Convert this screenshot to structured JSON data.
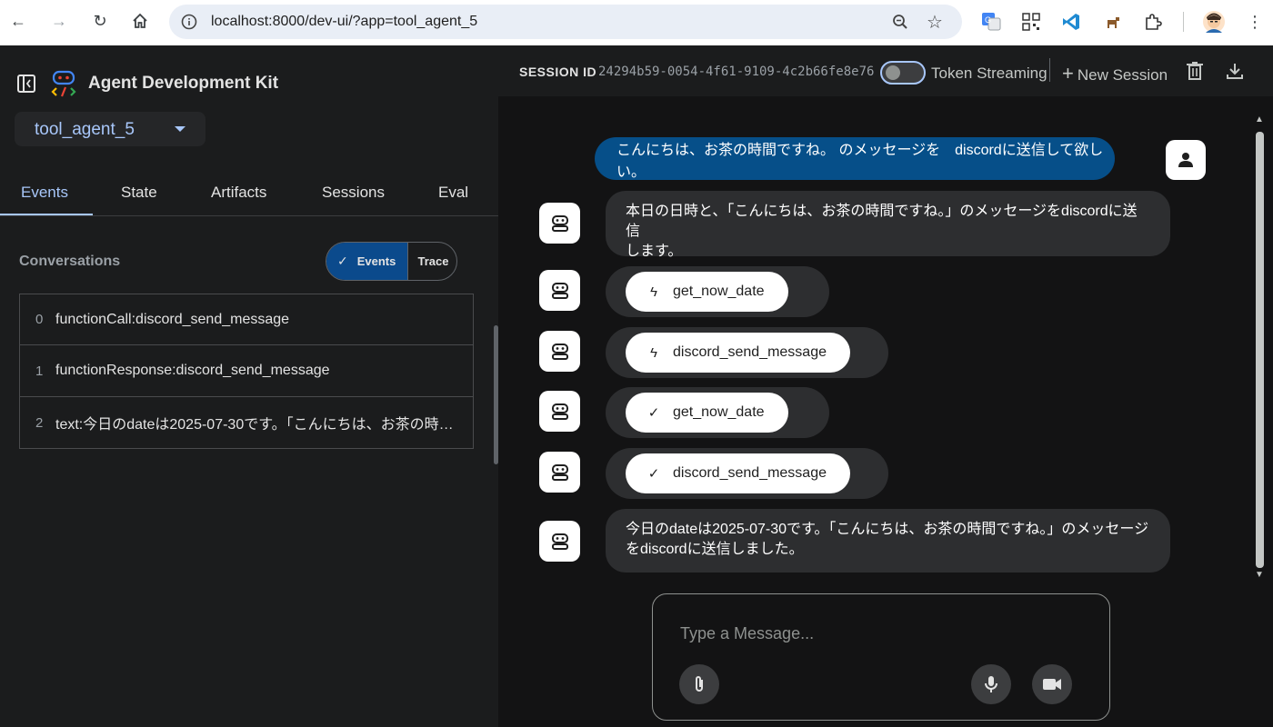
{
  "browser": {
    "url": "localhost:8000/dev-ui/?app=tool_agent_5"
  },
  "sidebar": {
    "title": "Agent Development Kit",
    "app_selected": "tool_agent_5",
    "tabs": [
      {
        "label": "Events"
      },
      {
        "label": "State"
      },
      {
        "label": "Artifacts"
      },
      {
        "label": "Sessions"
      },
      {
        "label": "Eval"
      }
    ],
    "conversations_label": "Conversations",
    "view_toggle": {
      "events": "Events",
      "trace": "Trace"
    },
    "events": [
      {
        "index": "0",
        "text": "functionCall:discord_send_message"
      },
      {
        "index": "1",
        "text": "functionResponse:discord_send_message"
      },
      {
        "index": "2",
        "text": "text:今日のdateは2025-07-30です。「こんにちは、お茶の時…"
      }
    ]
  },
  "session": {
    "label": "SESSION ID",
    "id": "24294b59-0054-4f61-9109-4c2b66fe8e76",
    "token_streaming_label": "Token Streaming",
    "token_streaming_on": false,
    "new_session_label": "New Session"
  },
  "chat": {
    "user_message": "こんにちは、お茶の時間ですね。 のメッセージを　discordに送信して欲しい。",
    "bot_intro_line1": "本日の日時と、「こんにちは、お茶の時間ですね。」のメッセージをdiscordに送信",
    "bot_intro_line2": "します。",
    "tool_calls": [
      {
        "name": "get_now_date",
        "kind": "call"
      },
      {
        "name": "discord_send_message",
        "kind": "call"
      },
      {
        "name": "get_now_date",
        "kind": "response"
      },
      {
        "name": "discord_send_message",
        "kind": "response"
      }
    ],
    "bot_final_line1": "今日のdateは2025-07-30です。「こんにちは、お茶の時間ですね。」のメッセージ",
    "bot_final_line2": "をdiscordに送信しました。"
  },
  "composer": {
    "placeholder": "Type a Message..."
  },
  "colors": {
    "accent": "#a8c7fa",
    "user_bubble": "#064f89",
    "bot_bubble": "#2d2e30",
    "events_toggle": "#0b4a8c"
  }
}
